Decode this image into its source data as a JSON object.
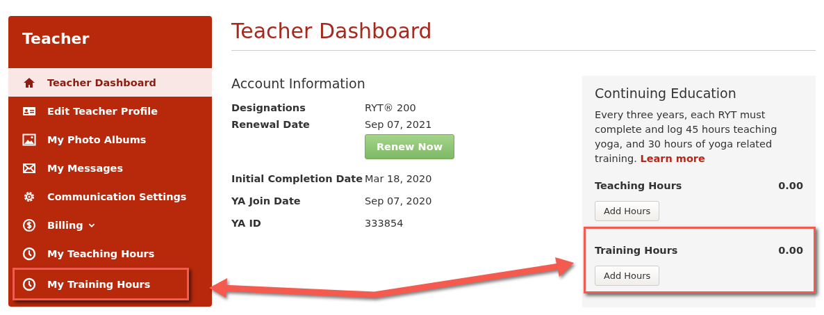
{
  "sidebar": {
    "title": "Teacher",
    "items": [
      {
        "label": "Teacher Dashboard",
        "kind": "home",
        "selected": true,
        "highlighted": false,
        "expandable": false
      },
      {
        "label": "Edit Teacher Profile",
        "kind": "card",
        "selected": false,
        "highlighted": false,
        "expandable": false
      },
      {
        "label": "My Photo Albums",
        "kind": "photo",
        "selected": false,
        "highlighted": false,
        "expandable": false
      },
      {
        "label": "My Messages",
        "kind": "mail",
        "selected": false,
        "highlighted": false,
        "expandable": false
      },
      {
        "label": "Communication Settings",
        "kind": "gear",
        "selected": false,
        "highlighted": false,
        "expandable": false
      },
      {
        "label": "Billing",
        "kind": "dollar",
        "selected": false,
        "highlighted": false,
        "expandable": true
      },
      {
        "label": "My Teaching Hours",
        "kind": "clock",
        "selected": false,
        "highlighted": false,
        "expandable": false
      },
      {
        "label": "My Training Hours",
        "kind": "clock",
        "selected": false,
        "highlighted": true,
        "expandable": false
      }
    ]
  },
  "page_title": "Teacher Dashboard",
  "account_information": {
    "title": "Account Information",
    "rows": [
      {
        "label": "Designations",
        "value": "RYT® 200"
      },
      {
        "label": "Renewal Date",
        "value": "Sep 07, 2021",
        "action": "Renew Now"
      },
      {
        "label": "Initial Completion Date",
        "value": "Mar 18, 2020"
      },
      {
        "label": "YA Join Date",
        "value": "Sep 07, 2020"
      },
      {
        "label": "YA ID",
        "value": "333854"
      }
    ]
  },
  "continuing_education": {
    "title": "Continuing Education",
    "text": "Every three years, each RYT must complete and log 45 hours teaching yoga, and 30 hours of yoga related training.",
    "link": "Learn more",
    "sections": [
      {
        "label": "Teaching Hours",
        "value": "0.00",
        "button": "Add Hours",
        "highlighted": false
      },
      {
        "label": "Training Hours",
        "value": "0.00",
        "button": "Add Hours",
        "highlighted": true
      }
    ]
  }
}
